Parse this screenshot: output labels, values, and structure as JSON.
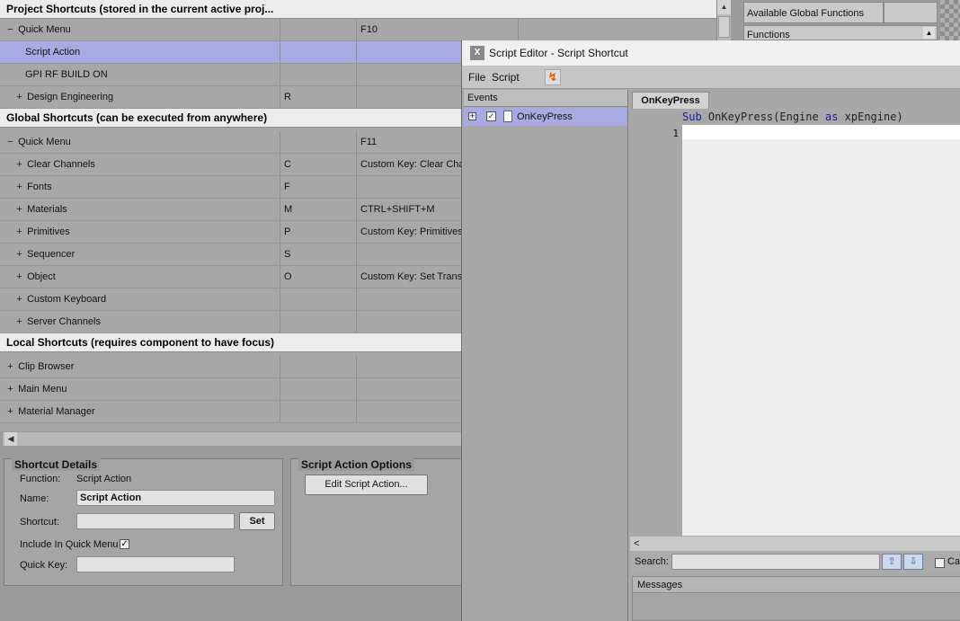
{
  "grid": {
    "project_section": "Project Shortcuts (stored in the current active proj...",
    "global_section": "Global Shortcuts (can be executed from anywhere)",
    "local_section": "Local Shortcuts (requires component to have focus)",
    "project_rows": [
      {
        "expander": "−",
        "name": "Quick Menu",
        "key": "",
        "action": "F10"
      },
      {
        "expander": "",
        "name": "Script Action",
        "key": "",
        "action": ""
      },
      {
        "expander": "",
        "name": "GPI RF BUILD ON",
        "key": "",
        "action": ""
      },
      {
        "expander": "+",
        "name": "Design Engineering",
        "key": "R",
        "action": ""
      }
    ],
    "global_rows": [
      {
        "expander": "−",
        "name": "Quick Menu",
        "key": "",
        "action": "F11"
      },
      {
        "expander": "+",
        "name": "Clear Channels",
        "key": "C",
        "action": "Custom Key: Clear Chan"
      },
      {
        "expander": "+",
        "name": "Fonts",
        "key": "F",
        "action": ""
      },
      {
        "expander": "+",
        "name": "Materials",
        "key": "M",
        "action": "CTRL+SHIFT+M"
      },
      {
        "expander": "+",
        "name": "Primitives",
        "key": "P",
        "action": "Custom Key: Primitives"
      },
      {
        "expander": "+",
        "name": "Sequencer",
        "key": "S",
        "action": ""
      },
      {
        "expander": "+",
        "name": "Object",
        "key": "O",
        "action": "Custom Key: Set Transf"
      },
      {
        "expander": "+",
        "name": "Custom Keyboard",
        "key": "",
        "action": ""
      },
      {
        "expander": "+",
        "name": "Server Channels",
        "key": "",
        "action": ""
      }
    ],
    "local_rows": [
      {
        "expander": "+",
        "name": "Clip Browser",
        "key": "",
        "action": ""
      },
      {
        "expander": "+",
        "name": "Main Menu",
        "key": "",
        "action": ""
      },
      {
        "expander": "+",
        "name": "Material Manager",
        "key": "",
        "action": ""
      }
    ],
    "selected_row": "Script Action"
  },
  "right_panel": {
    "tab_label": "Available Global Functions",
    "functions_label": "Functions"
  },
  "details": {
    "title": "Shortcut Details",
    "function_label": "Function:",
    "function_value": "Script Action",
    "name_label": "Name:",
    "name_value": "Script Action",
    "shortcut_label": "Shortcut:",
    "shortcut_value": "",
    "set_button": "Set",
    "include_label": "Include In Quick Menu",
    "include_checked": "✓",
    "quickkey_label": "Quick Key:",
    "quickkey_value": ""
  },
  "action_options": {
    "title": "Script Action Options",
    "edit_button": "Edit Script Action..."
  },
  "editor": {
    "title": "Script Editor - Script Shortcut",
    "menu_file": "File",
    "menu_script": "Script",
    "events_header": "Events",
    "event_item": "OnKeyPress",
    "event_checked": "✓",
    "code_tab": "OnKeyPress",
    "sig_kw1": "Sub",
    "sig_mid": " OnKeyPress(Engine ",
    "sig_kw2": "as",
    "sig_end": " xpEngine)",
    "line_number": "1",
    "search_label": "Search:",
    "search_value": "",
    "case_label": "Cas",
    "messages_header": "Messages",
    "hscroll_arrow": "<"
  }
}
